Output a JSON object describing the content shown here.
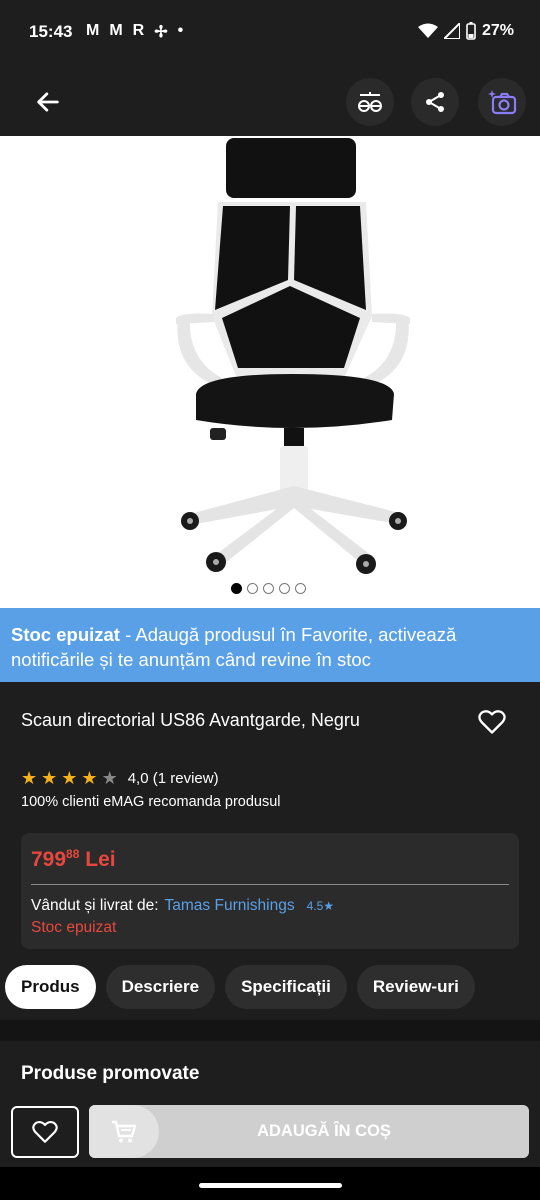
{
  "status_bar": {
    "time": "15:43",
    "notification_icons": [
      "M",
      "M",
      "R",
      "✢",
      "•"
    ],
    "battery": "27%"
  },
  "product": {
    "stock_banner_bold": "Stoc epuizat",
    "stock_banner_text": " - Adaugă produsul în Favorite, activează notificările și te anunțăm când revine în stoc",
    "title": "Scaun directorial US86 Avantgarde, Negru",
    "rating": 4,
    "rating_text": "4,0 (1 review)",
    "recommend_text": "100% clienti eMAG recomanda produsul",
    "price_main": "799",
    "price_decimals": "88",
    "price_currency": "Lei",
    "seller_label": "Vândut și livrat de:",
    "seller_name": "Tamas Furnishings",
    "seller_score": "4.5★",
    "stock_status": "Stoc epuizat",
    "image_count": 5,
    "active_image": 1
  },
  "tabs": [
    "Produs",
    "Descriere",
    "Specificații",
    "Review-uri"
  ],
  "promo_title": "Produse promovate",
  "cart_button": "ADAUGĂ ÎN COȘ",
  "colors": {
    "accent_blue": "#5aa0e6",
    "price_red": "#e8473f",
    "star": "#f6b21b",
    "surface": "#1e1e1e"
  }
}
